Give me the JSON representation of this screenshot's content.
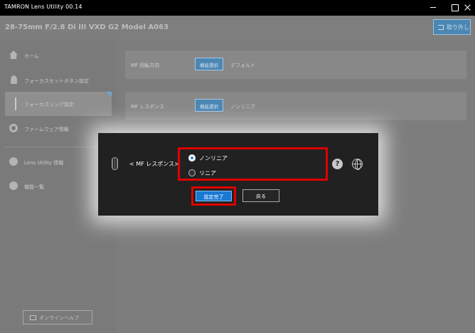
{
  "window": {
    "title": "TAMRON Lens Utility  00.14"
  },
  "header": {
    "lens_name": "28-75mm F/2.8 Di III VXD G2   Model A063",
    "read_button": "取り外し"
  },
  "sidebar": {
    "items": [
      {
        "label": "ホーム",
        "icon": "home-icon"
      },
      {
        "label": "フォーカスセットボタン設定",
        "icon": "focus-set-icon"
      },
      {
        "label": "フォーカスリング設定",
        "icon": "focus-ring-icon",
        "active": true
      },
      {
        "label": "ファームウェア情報",
        "icon": "firmware-icon"
      },
      {
        "label": "Lens Utility 情報",
        "icon": "info-icon"
      },
      {
        "label": "機能一覧",
        "icon": "function-list-icon"
      }
    ],
    "help_button": "オンラインヘルプ"
  },
  "main": {
    "settings": [
      {
        "name": "MF 回転方向",
        "select_label": "機能選択",
        "value": "デフォルト"
      },
      {
        "name": "MF レスポンス",
        "select_label": "機能選択",
        "value": "ノンリニア"
      }
    ]
  },
  "dialog": {
    "label": "< MF レスポンス>",
    "options": [
      {
        "label": "ノンリニア",
        "selected": true
      },
      {
        "label": "リニア",
        "selected": false
      }
    ],
    "confirm_button": "設定完了",
    "back_button": "戻る",
    "help_symbol": "?"
  },
  "colors": {
    "accent": "#1878d2",
    "highlight_frame": "#e00000",
    "dialog_bg": "#212121"
  }
}
